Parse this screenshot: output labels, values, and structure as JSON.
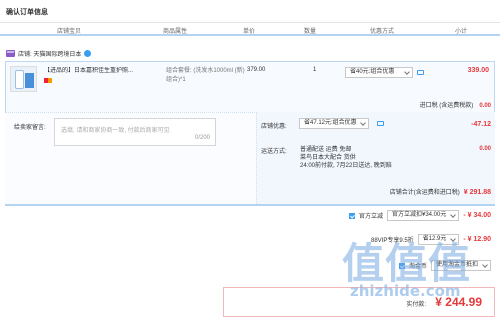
{
  "page": {
    "title": "确认订单信息"
  },
  "columns": [
    "店铺宝贝",
    "商品属性",
    "单价",
    "数量",
    "优惠方式",
    "小计"
  ],
  "store": {
    "name": "店铺: 天猫国际跨境日本"
  },
  "item": {
    "title": "【进品的】日本嘉积佳生重护照...",
    "spec_line1": "组合套餐: (洗发水1000ml (新)",
    "spec_line2": "组合)*1",
    "price": "379.00",
    "qty": "1",
    "promo": "省40元:组合优惠",
    "subtotal": "339.00"
  },
  "tax": {
    "label": "进口税 (含运费税款)",
    "value": "0.00"
  },
  "memo": {
    "label": "给卖家留言:",
    "placeholder": "选填, 请和商家协商一致, 付款后商家可见",
    "counter": "0/200"
  },
  "store_coupon": {
    "label": "店铺优惠:",
    "select": "省47.12元:组合优惠",
    "value": "-47.12"
  },
  "shipping": {
    "label": "运送方式:",
    "line1": "普通配送 运费 免邮",
    "line2": "菜鸟日本大配合  货供",
    "line3": "24:00前付款, 7月22日送达, 晚到赔",
    "value": "0.00"
  },
  "store_total": {
    "label": "店铺合计(含运费和进口税)",
    "value": "¥ 291.88"
  },
  "discounts": [
    {
      "label": "官方立减",
      "select": "官方立减扣¥34.00元",
      "value": "- ¥ 34.00",
      "checked": true
    },
    {
      "label": "88VIP专享9.5折",
      "select": "省12.9元",
      "value": "- ¥ 12.90",
      "checked": false
    },
    {
      "label": "淘金币",
      "select": "使用淘金币抵扣",
      "value": "",
      "checked": true
    }
  ],
  "payment": {
    "label": "实付款:",
    "value": "¥ 244.99"
  },
  "watermark": {
    "glyphs": "值值值",
    "url": "zhizhide.com"
  },
  "colors": {
    "accent": "#e4393c",
    "link_blue": "#3a9ff0",
    "border_blue": "#b3d4f0"
  }
}
